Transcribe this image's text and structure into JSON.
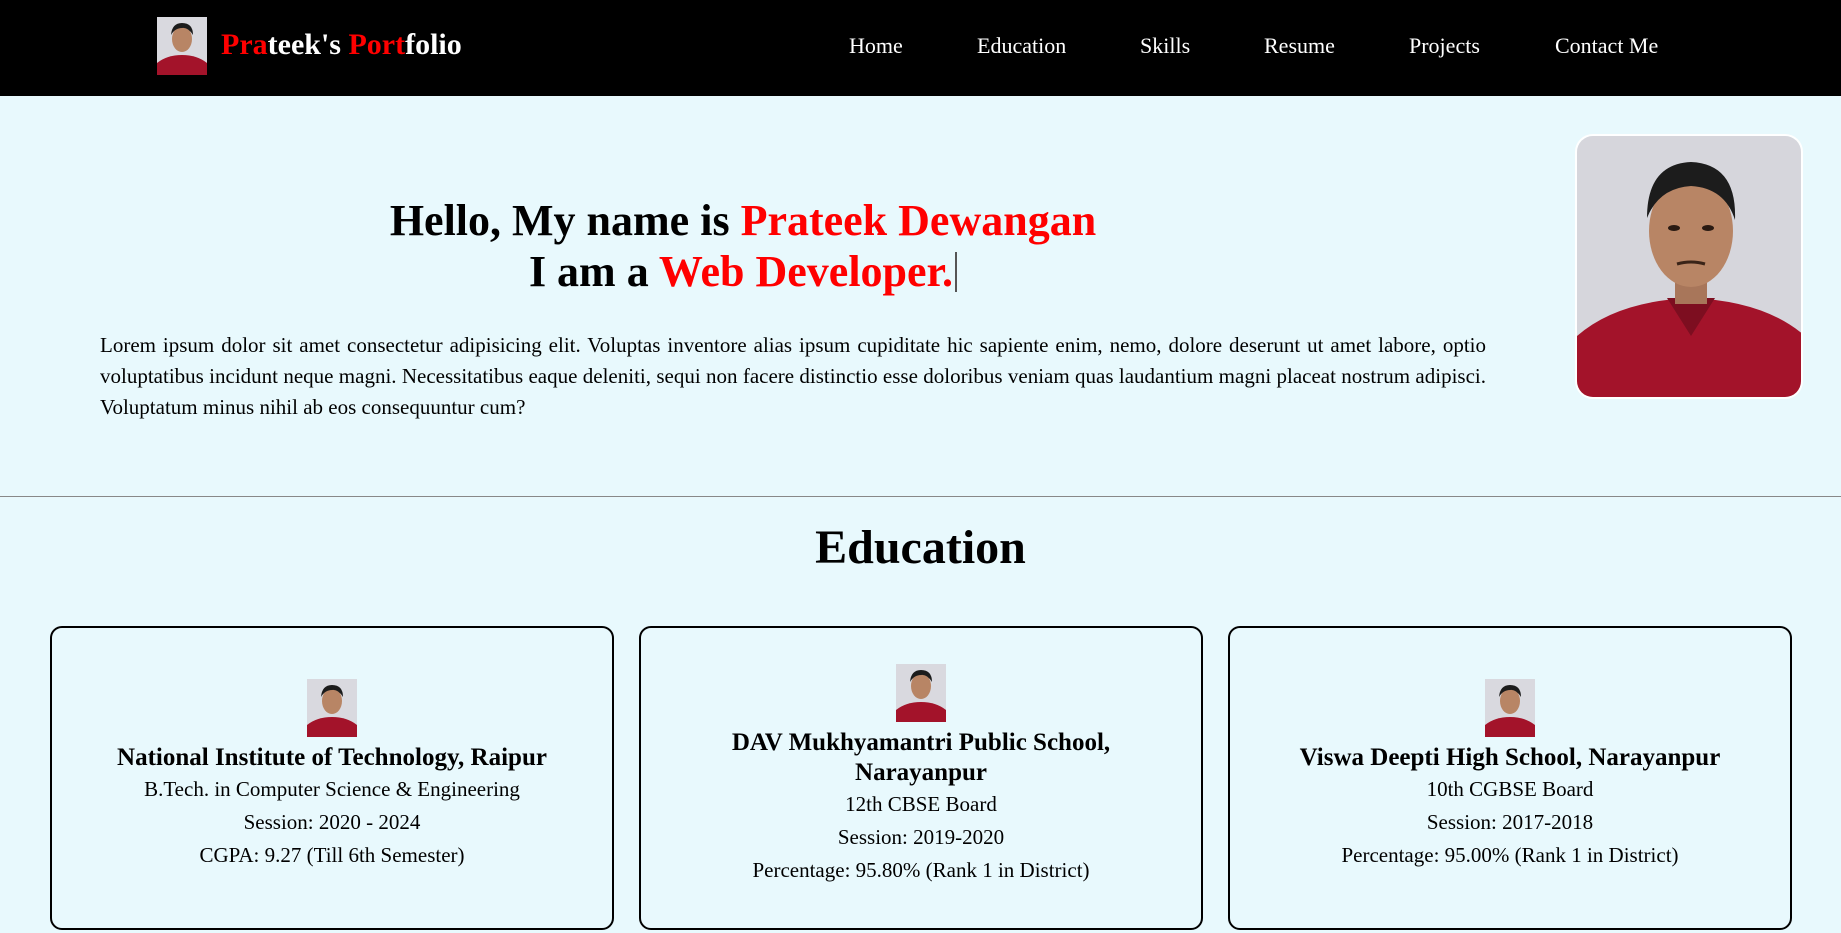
{
  "navbar": {
    "brand_parts": [
      "Pra",
      "teek's ",
      "Port",
      "folio"
    ],
    "links": [
      "Home",
      "Education",
      "Skills",
      "Resume",
      "Projects",
      "Contact Me"
    ]
  },
  "hero": {
    "line1_prefix": "Hello, My name is ",
    "name": "Prateek Dewangan",
    "line2_prefix": "I am a ",
    "role": "Web Developer.",
    "paragraph": "Lorem ipsum dolor sit amet consectetur adipisicing elit. Voluptas inventore alias ipsum cupiditate hic sapiente enim, nemo, dolore deserunt ut amet labore, optio voluptatibus incidunt neque magni. Necessitatibus eaque deleniti, sequi non facere distinctio esse doloribus veniam quas laudantium magni placeat nostrum adipisci. Voluptatum minus nihil ab eos consequuntur cum?"
  },
  "education": {
    "title": "Education",
    "cards": [
      {
        "name": "National Institute of Technology, Raipur",
        "program": "B.Tech. in Computer Science & Engineering",
        "session": "Session: 2020 - 2024",
        "score": "CGPA: 9.27 (Till 6th Semester)"
      },
      {
        "name": "DAV Mukhyamantri Public School, Narayanpur",
        "program": "12th CBSE Board",
        "session": "Session: 2019-2020",
        "score": "Percentage: 95.80% (Rank 1 in District)"
      },
      {
        "name": "Viswa Deepti High School, Narayanpur",
        "program": "10th CGBSE Board",
        "session": "Session: 2017-2018",
        "score": "Percentage: 95.00% (Rank 1 in District)"
      }
    ]
  },
  "colors": {
    "accent": "#ff0000",
    "navbar_bg": "#000000",
    "page_bg": "#e8f9fd"
  }
}
